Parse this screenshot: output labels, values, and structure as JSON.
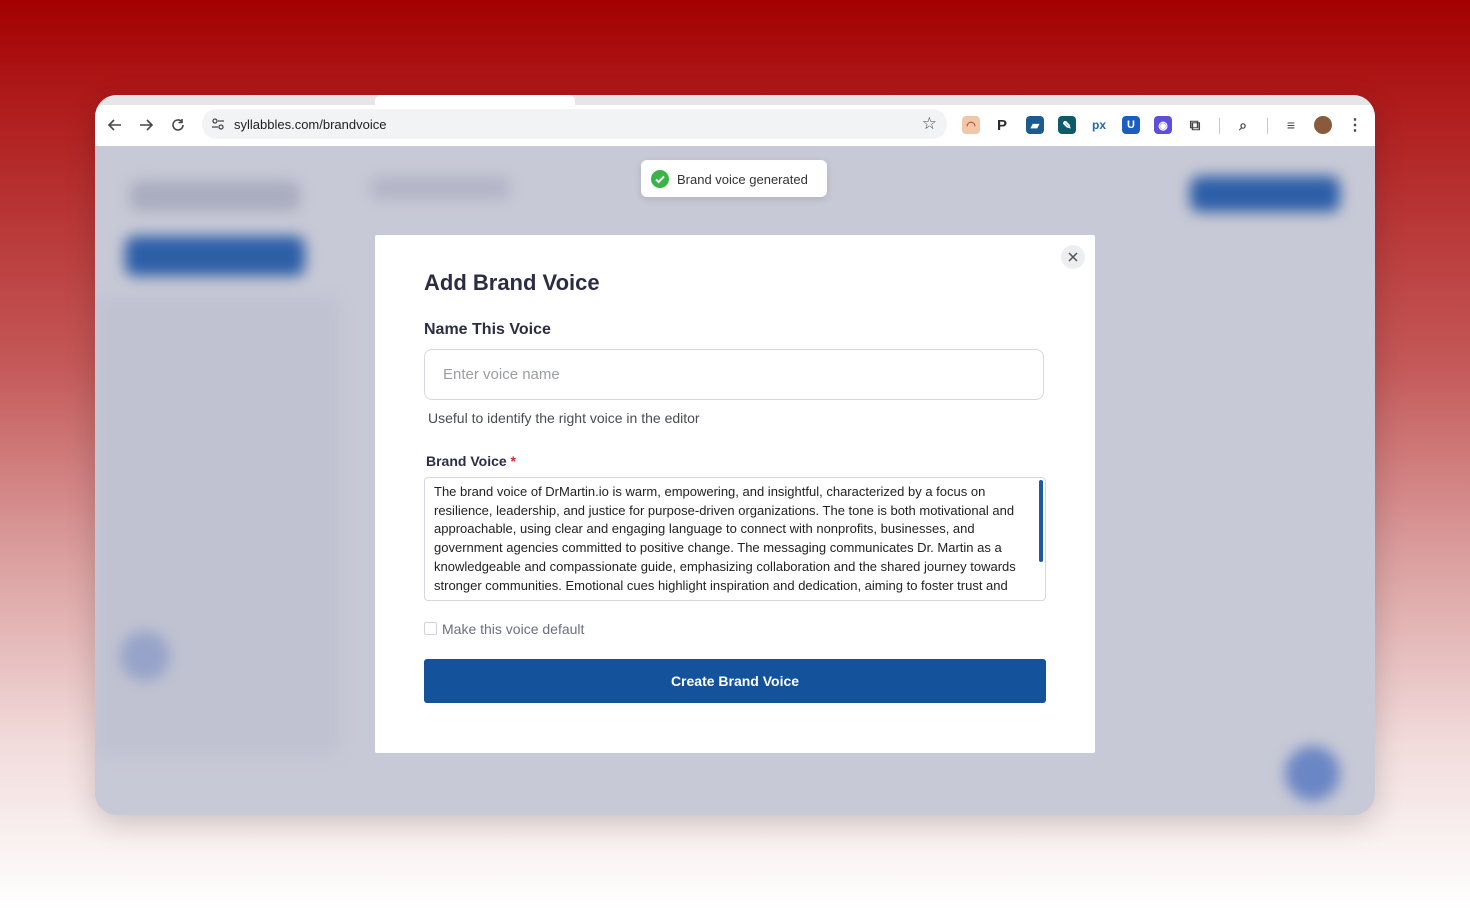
{
  "browser": {
    "url": "syllabbles.com/brandvoice",
    "extensions": [
      {
        "name": "ext-pie-icon",
        "color": "#e7a069",
        "label": ""
      },
      {
        "name": "ext-p-icon",
        "color": "#2b2b2b",
        "label": "P"
      },
      {
        "name": "ext-blue-note-icon",
        "color": "#1d5a8f",
        "label": "▰"
      },
      {
        "name": "ext-green-pen-icon",
        "color": "#0e5a6b",
        "label": "✎"
      },
      {
        "name": "ext-px-icon",
        "color": "#1a66c4",
        "label": "px"
      },
      {
        "name": "ext-shield-icon",
        "color": "#1b5ec2",
        "label": "U"
      },
      {
        "name": "ext-purple-icon",
        "color": "#5b4fdb",
        "label": "◉"
      }
    ]
  },
  "toast": {
    "text": "Brand voice generated"
  },
  "modal": {
    "title": "Add Brand Voice",
    "name_label": "Name This Voice",
    "name_placeholder": "Enter voice name",
    "name_value": "",
    "helper": "Useful to identify the right voice in the editor",
    "brand_voice_label": "Brand Voice",
    "required_mark": "*",
    "brand_voice_text": "The brand voice of DrMartin.io is warm, empowering, and insightful, characterized by a focus on resilience, leadership, and justice for purpose-driven organizations. The tone is both motivational and approachable, using clear and engaging language to connect with nonprofits, businesses, and government agencies committed to positive change. The messaging communicates Dr. Martin as a knowledgeable and compassionate guide, emphasizing collaboration and the shared journey towards stronger communities. Emotional cues highlight inspiration and dedication, aiming to foster trust and",
    "default_label": "Make this voice default",
    "default_checked": false,
    "create_label": "Create Brand Voice"
  },
  "colors": {
    "primary_button": "#14539b",
    "toast_success": "#3ab449",
    "required": "#e02424"
  }
}
